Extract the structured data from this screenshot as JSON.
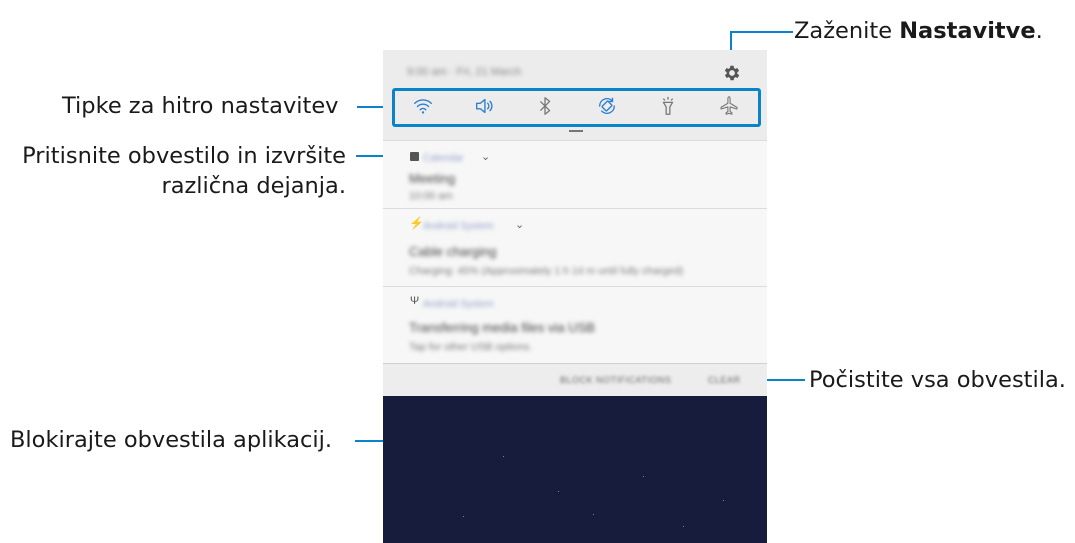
{
  "callouts": {
    "settings_prefix": "Zaženite ",
    "settings_bold": "Nastavitve",
    "settings_suffix": ".",
    "quick_settings": "Tipke za hitro nastavitev",
    "notification_line1": "Pritisnite obvestilo in izvršite",
    "notification_line2": "različna dejanja.",
    "clear": "Počistite vsa obvestila.",
    "block": "Blokirajte obvestila aplikacij."
  },
  "phone": {
    "status_text": "9:00 am · Fri, 21 March",
    "quick_settings_icons": [
      "wifi-icon",
      "sound-icon",
      "bluetooth-icon",
      "auto-rotate-icon",
      "flashlight-icon",
      "airplane-mode-icon"
    ],
    "notifications": [
      {
        "icon": "calendar-icon",
        "app": "Calendar",
        "title": "Meeting",
        "sub": "10:00 am"
      },
      {
        "icon": "charging-icon",
        "app": "Android System",
        "title": "Cable charging",
        "sub": "Charging: 45% (Approximately 1 h 14 m until fully charged)"
      },
      {
        "icon": "usb-icon",
        "app": "Android System",
        "title": "Transferring media files via USB",
        "sub": "Tap for other USB options."
      }
    ],
    "block_button": "BLOCK NOTIFICATIONS",
    "clear_button": "CLEAR"
  },
  "colors": {
    "accent": "#0a84c9",
    "wallpaper": "#171c3d",
    "active_icon": "#2f7fcf"
  }
}
